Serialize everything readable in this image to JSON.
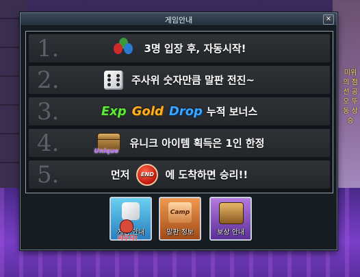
{
  "window": {
    "title": "게임안내",
    "close_label": "×"
  },
  "rules": [
    {
      "num": "1.",
      "text": "3명 입장 후, 자동시작!",
      "icon": "balloons-icon"
    },
    {
      "num": "2.",
      "text": "주사위 숫자만큼 말판 전진~",
      "icon": "dice-icon"
    },
    {
      "num": "3.",
      "exp": "Exp",
      "gold": "Gold",
      "drop": "Drop",
      "text": "누적 보너스"
    },
    {
      "num": "4.",
      "text": "유니크 아이템 획득은 1인 한정",
      "icon": "unique-chest-icon",
      "icon_tag": "Unique"
    },
    {
      "num": "5.",
      "text_before": "먼저",
      "end_label": "END",
      "text_after": "에 도착하면 승리!!"
    }
  ],
  "buttons": {
    "game_label": "게임 안내",
    "board_label": "말판 정보",
    "board_art": "Camp",
    "reward_label": "보상 안내"
  },
  "cursor_label": "싸우자!",
  "side_text": "미위의 점선 공오 뚜동 상승",
  "colors": {
    "exp": "#5ee83a",
    "gold": "#ffb020",
    "drop": "#39a6ff",
    "title_bar": "#2b3845"
  }
}
